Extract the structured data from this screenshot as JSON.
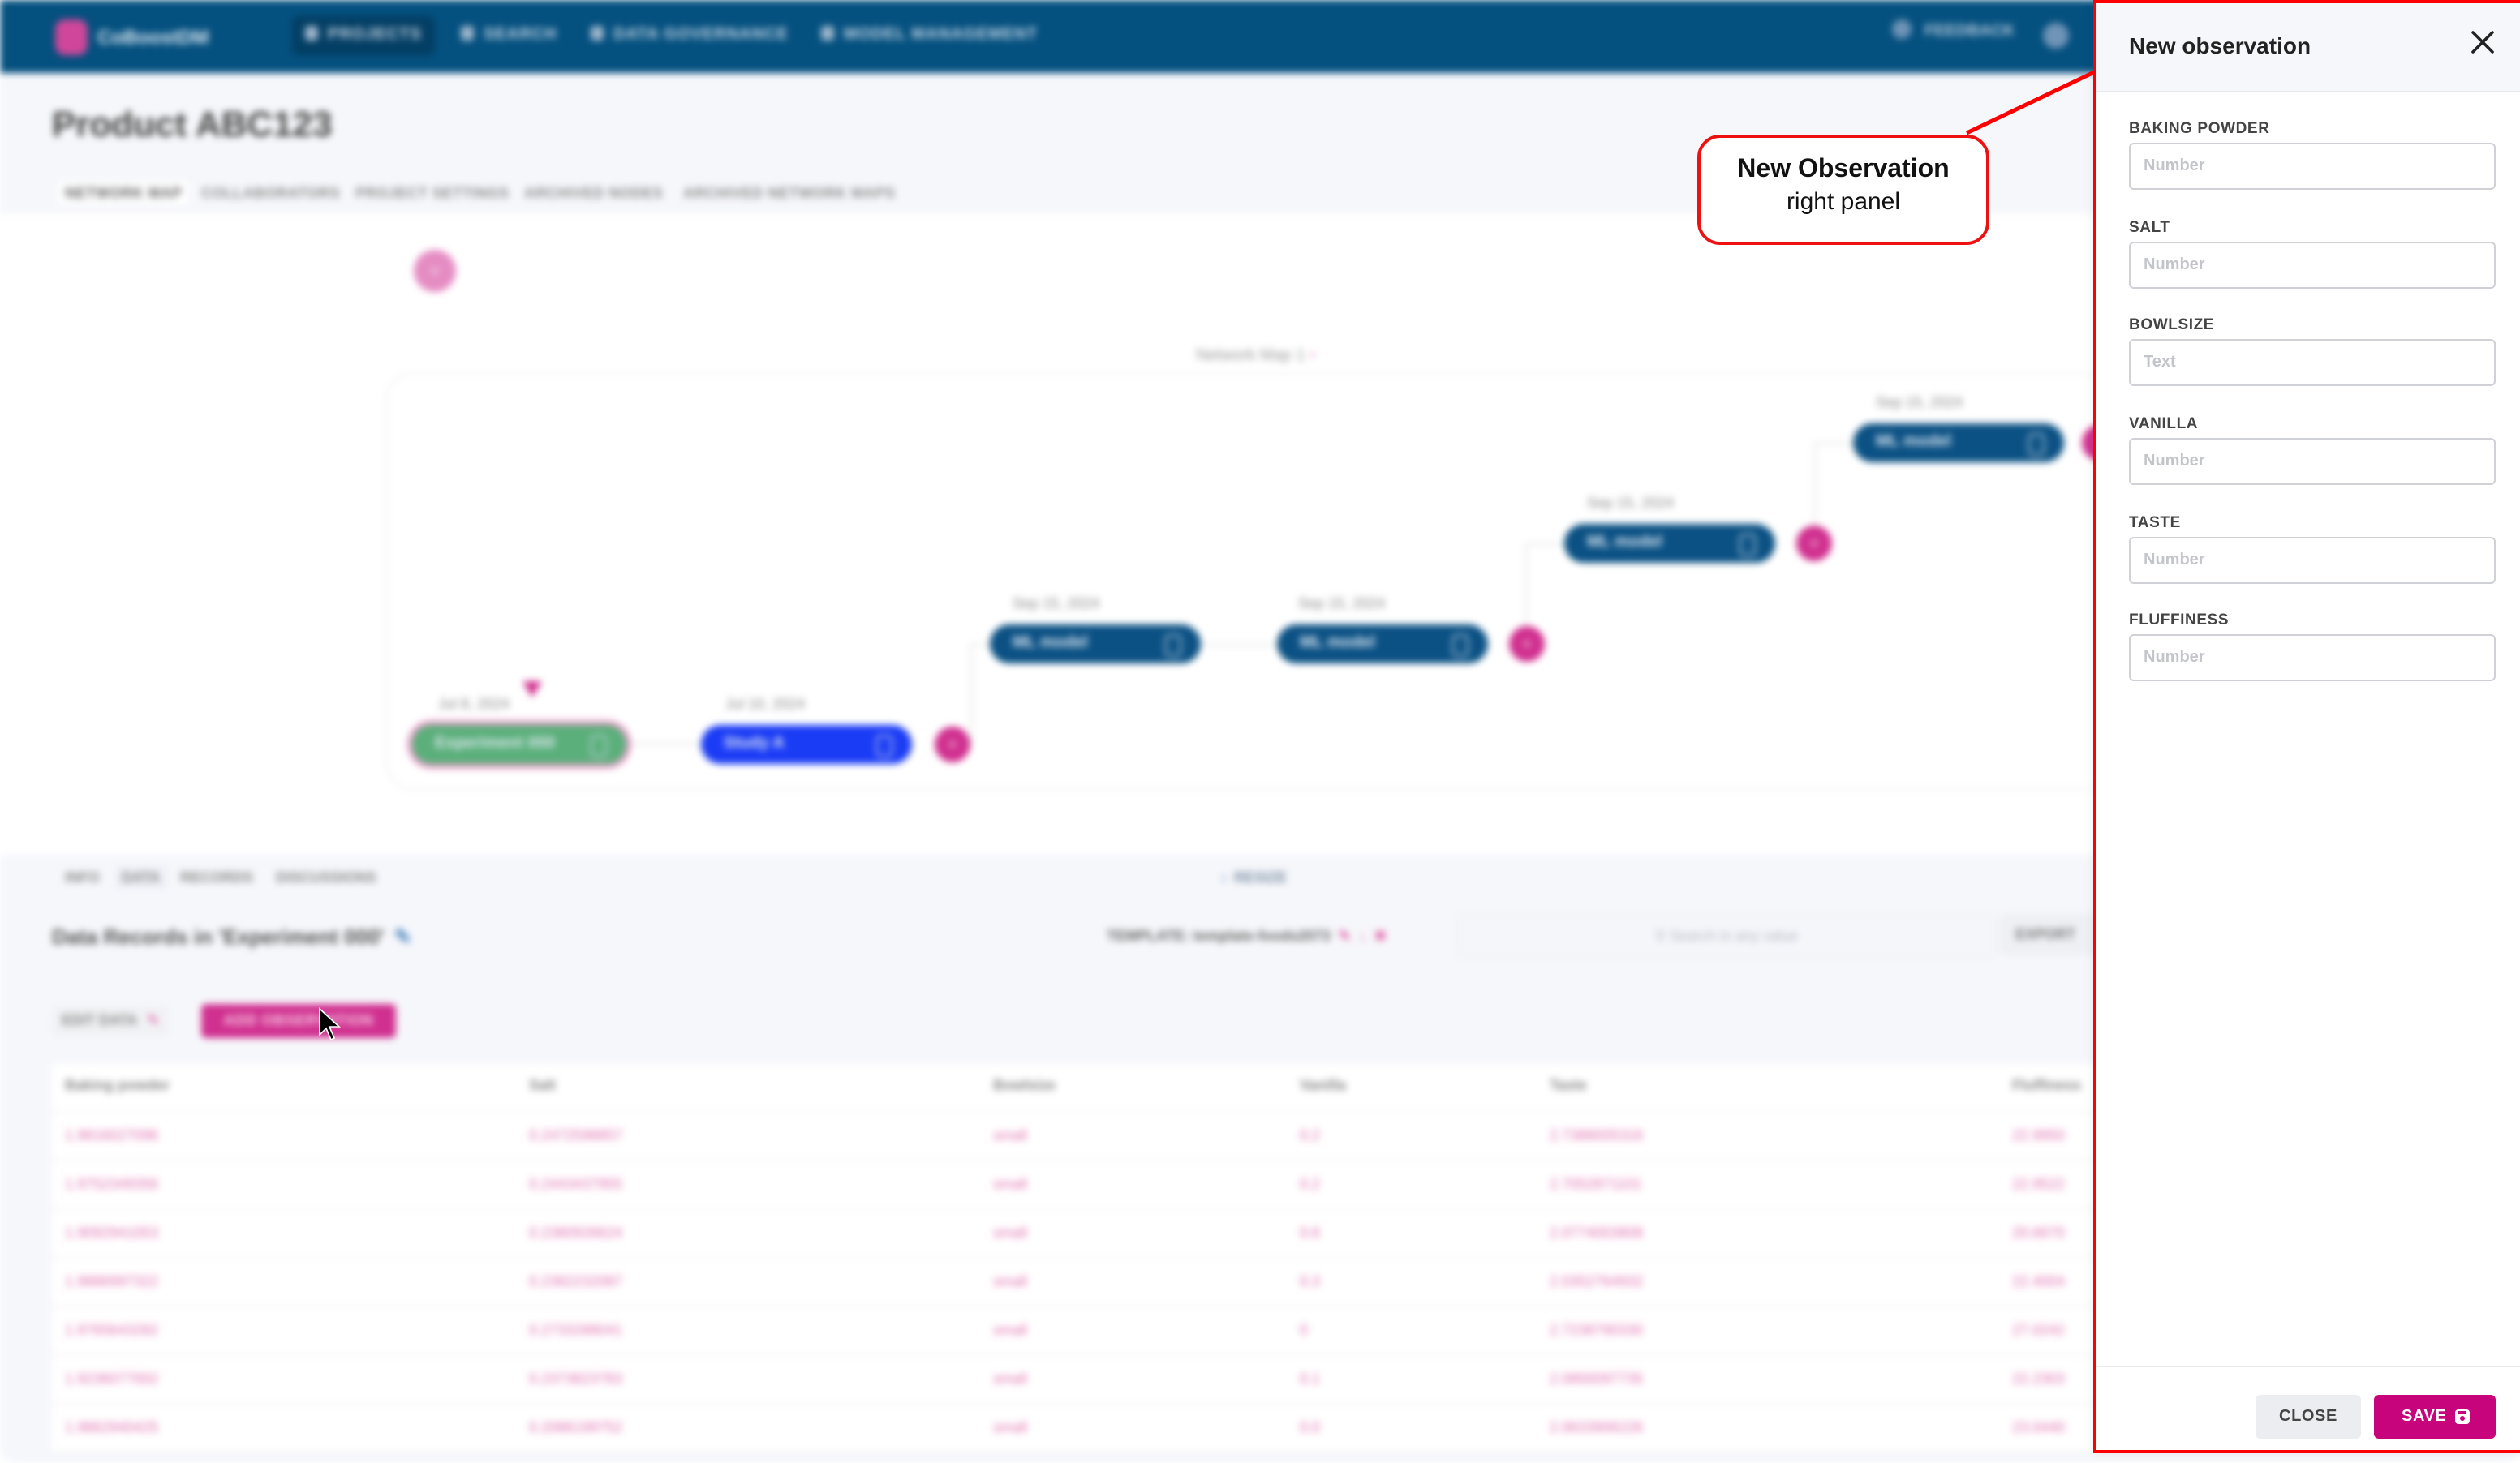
{
  "app": {
    "brand": "CoBoostDM",
    "nav": [
      {
        "label": "PROJECTS",
        "icon": "folder-icon",
        "active": true
      },
      {
        "label": "SEARCH",
        "icon": "search-icon",
        "active": false
      },
      {
        "label": "DATA GOVERNANCE",
        "icon": "database-icon",
        "active": false
      },
      {
        "label": "MODEL MANAGEMENT",
        "icon": "chart-icon",
        "active": false
      }
    ],
    "feedback_label": "FEEDBACK"
  },
  "page": {
    "title": "Product ABC123",
    "tabs": [
      {
        "label": "NETWORK MAP",
        "active": true
      },
      {
        "label": "COLLABORATORS",
        "active": false
      },
      {
        "label": "PROJECT SETTINGS",
        "active": false
      },
      {
        "label": "ARCHIVED NODES",
        "active": false
      },
      {
        "label": "ARCHIVED NETWORK MAPS",
        "active": false
      }
    ]
  },
  "network_map": {
    "label": "Network Map 1",
    "label_suffix": "•",
    "nodes": [
      {
        "label": "Experiment 000",
        "date": "Jul 8, 2024",
        "type": "experiment"
      },
      {
        "label": "Study A",
        "date": "Jul 10, 2024",
        "type": "study"
      },
      {
        "label": "ML model",
        "date": "Sep 15, 2024",
        "type": "model"
      },
      {
        "label": "ML model",
        "date": "Sep 15, 2024",
        "type": "model"
      },
      {
        "label": "ML model",
        "date": "Sep 15, 2024",
        "type": "model"
      },
      {
        "label": "ML model",
        "date": "Sep 15, 2024",
        "type": "model"
      }
    ],
    "add_label": "+"
  },
  "bottom_tabs": [
    {
      "label": "INFO",
      "active": false
    },
    {
      "label": "DATA",
      "active": true
    },
    {
      "label": "RECORDS",
      "active": false
    },
    {
      "label": "DISCUSSIONS",
      "active": false
    }
  ],
  "resize_label": "RESIZE",
  "data_section": {
    "title": "Data Records in 'Experiment 000'",
    "template_label": "TEMPLATE: template-foods2073",
    "search_placeholder": "Search in any value",
    "export_label": "EXPORT",
    "edit_data_label": "EDIT DATA",
    "add_observation_label": "ADD OBSERVATION",
    "columns": [
      "Baking powder",
      "Salt",
      "Bowlsize",
      "Vanilla",
      "Taste",
      "Fluffiness"
    ],
    "rows": [
      [
        "1.9816027096",
        "0.2472598857",
        "small",
        "0.2",
        "2.7388005316",
        "22.9950"
      ],
      [
        "1.9752349356",
        "0.2443437955",
        "small",
        "0.2",
        "2.7052871101",
        "22.9522"
      ],
      [
        "1.9092941053",
        "0.2380926624",
        "small",
        "0.6",
        "2.0774003808",
        "20.6670"
      ],
      [
        "1.9886997322",
        "0.2382232087",
        "small",
        "0.3",
        "2.0352764932",
        "22.4004"
      ],
      [
        "1.9765643282",
        "0.2733288041",
        "small",
        "0",
        "2.7238790330",
        "27.0242"
      ],
      [
        "1.9236077002",
        "0.2373823783",
        "small",
        "0.1",
        "2.0800097735",
        "22.2303"
      ],
      [
        "1.9862940425",
        "0.2086199752",
        "small",
        "0.0",
        "2.0633906226",
        "23.0440"
      ]
    ]
  },
  "callout": {
    "title": "New Observation",
    "subtitle": "right panel",
    "color": "#ff0000"
  },
  "panel": {
    "title": "New observation",
    "fields": [
      {
        "label": "BAKING POWDER",
        "placeholder": "Number",
        "value": ""
      },
      {
        "label": "SALT",
        "placeholder": "Number",
        "value": ""
      },
      {
        "label": "BOWLSIZE",
        "placeholder": "Text",
        "value": ""
      },
      {
        "label": "VANILLA",
        "placeholder": "Number",
        "value": ""
      },
      {
        "label": "TASTE",
        "placeholder": "Number",
        "value": ""
      },
      {
        "label": "FLUFFINESS",
        "placeholder": "Number",
        "value": ""
      }
    ],
    "close_label": "CLOSE",
    "save_label": "SAVE",
    "accent": "#c8047d"
  }
}
